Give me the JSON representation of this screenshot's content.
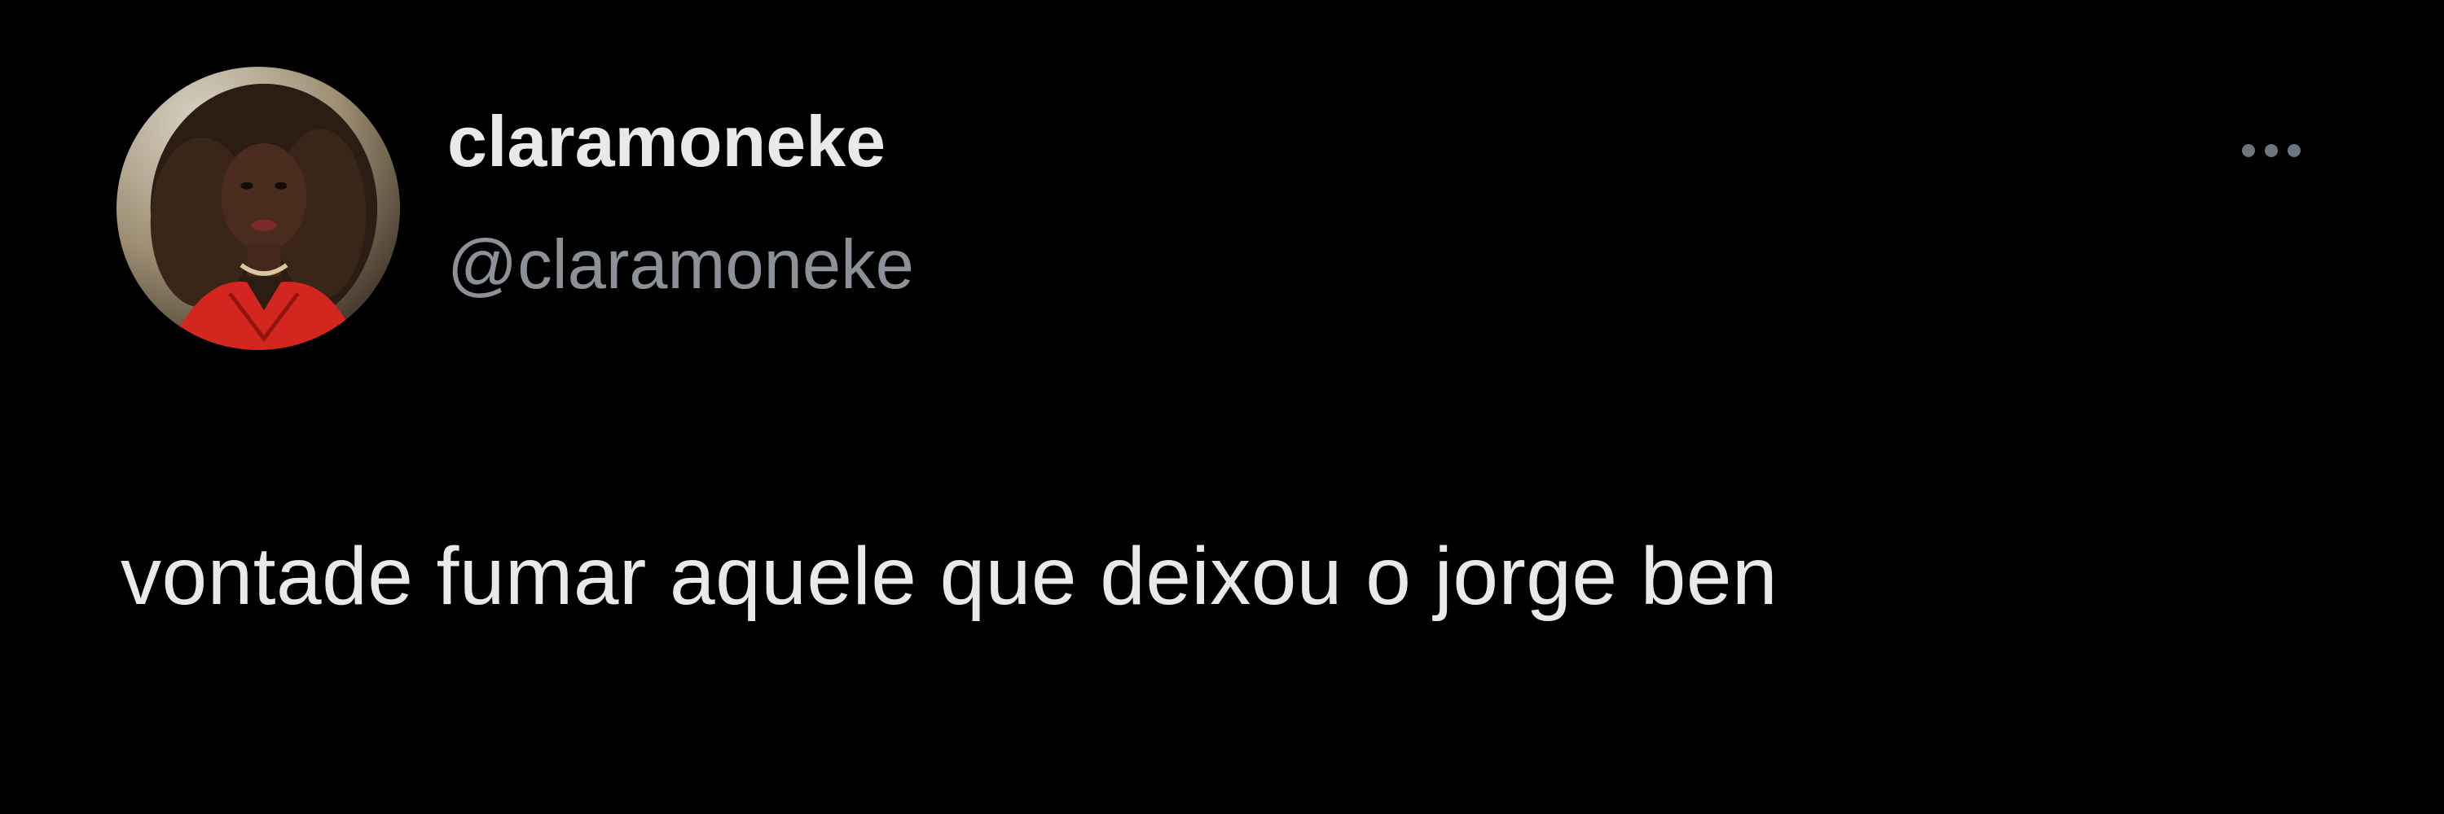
{
  "tweet": {
    "author": {
      "display_name": "claramoneke",
      "handle": "@claramoneke",
      "avatar": "profile-photo"
    },
    "menu": {
      "icon": "more-dots-icon"
    },
    "text": "vontade fumar aquele que deixou o jorge ben"
  },
  "colors": {
    "background": "#000000",
    "primary_text": "#e7e9ea",
    "secondary_text": "#8b9197",
    "icon": "#6e767d"
  }
}
